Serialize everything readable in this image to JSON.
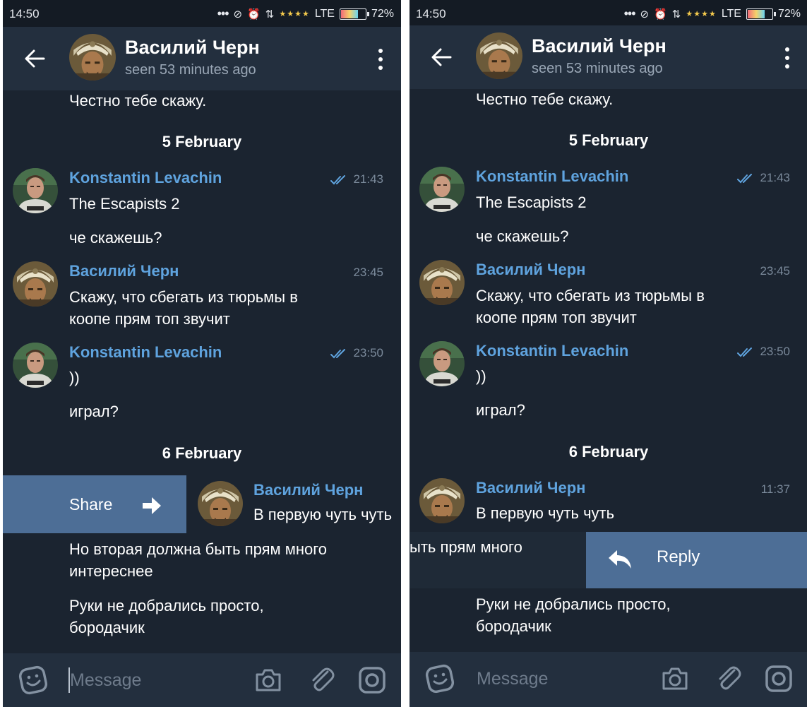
{
  "status_bar": {
    "time": "14:50",
    "network": "LTE",
    "battery": "72%"
  },
  "header": {
    "title": "Василий Черн",
    "status": "seen 53 minutes ago"
  },
  "messages": {
    "top_partial": "Честно тебе скажу.",
    "date_feb5": "5 February",
    "kl_author": "Konstantin Levachin",
    "kl_time_1": "21:43",
    "kl_text_1": "The Escapists 2",
    "kl_text_2": "че скажешь?",
    "vc_author": "Василий Черн",
    "vc_time_1": "23:45",
    "vc_text_1a": "Скажу, что сбегать из тюрьмы в",
    "vc_text_1b": "коопе прям топ звучит",
    "kl_time_2": "23:50",
    "kl_text_3": "))",
    "kl_text_4": "играл?",
    "date_feb6": "6 February",
    "vc_time_2": "11:37",
    "vc_text_2": "В первую чуть чуть",
    "vc_text_3a": "Но вторая должна быть прям много",
    "vc_text_3b": "интереснее",
    "vc_text_3b_partial": "ыть прям много",
    "vc_text_4a": "Руки не добрались просто,",
    "vc_text_4b": "бородачик"
  },
  "swipe": {
    "share_label": "Share",
    "reply_label": "Reply"
  },
  "composer": {
    "placeholder": "Message"
  },
  "colors": {
    "background": "#1b2430",
    "header": "#232f3e",
    "accent_name": "#5fa3de",
    "swipe_panel": "#4d6e96",
    "muted": "#7b8a9b"
  },
  "icons": [
    "back-arrow-icon",
    "more-vert-icon",
    "double-check-icon",
    "share-arrow-icon",
    "reply-icon",
    "emoji-icon",
    "camera-icon",
    "attach-clip-icon",
    "instagram-icon"
  ]
}
